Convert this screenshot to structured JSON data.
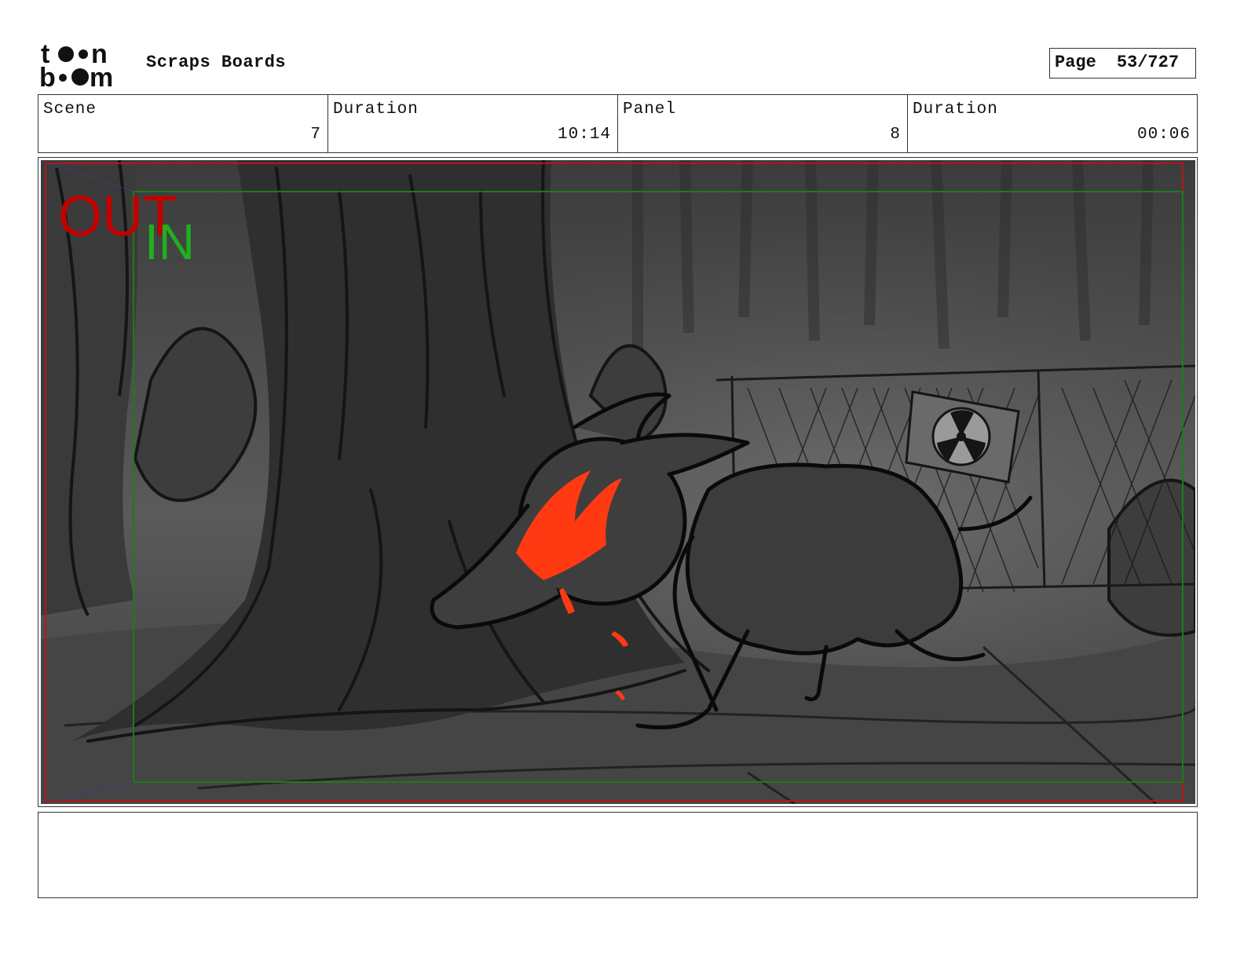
{
  "header": {
    "logo_text": "toonboom",
    "project_title": "Scraps Boards",
    "page_label": "Page",
    "page_value": "53/727"
  },
  "info": {
    "scene_label": "Scene",
    "scene_value": "7",
    "scene_duration_label": "Duration",
    "scene_duration_value": "10:14",
    "panel_label": "Panel",
    "panel_value": "8",
    "panel_duration_label": "Duration",
    "panel_duration_value": "00:06"
  },
  "panel": {
    "out_marker": "OUT",
    "in_marker": "IN",
    "out_color": "#c00000",
    "in_color": "#1fb01f",
    "frame_out_color": "#b01818",
    "frame_in_color": "#1e7a1e",
    "accent_color": "#ff3a12"
  },
  "notes": {
    "text": ""
  }
}
